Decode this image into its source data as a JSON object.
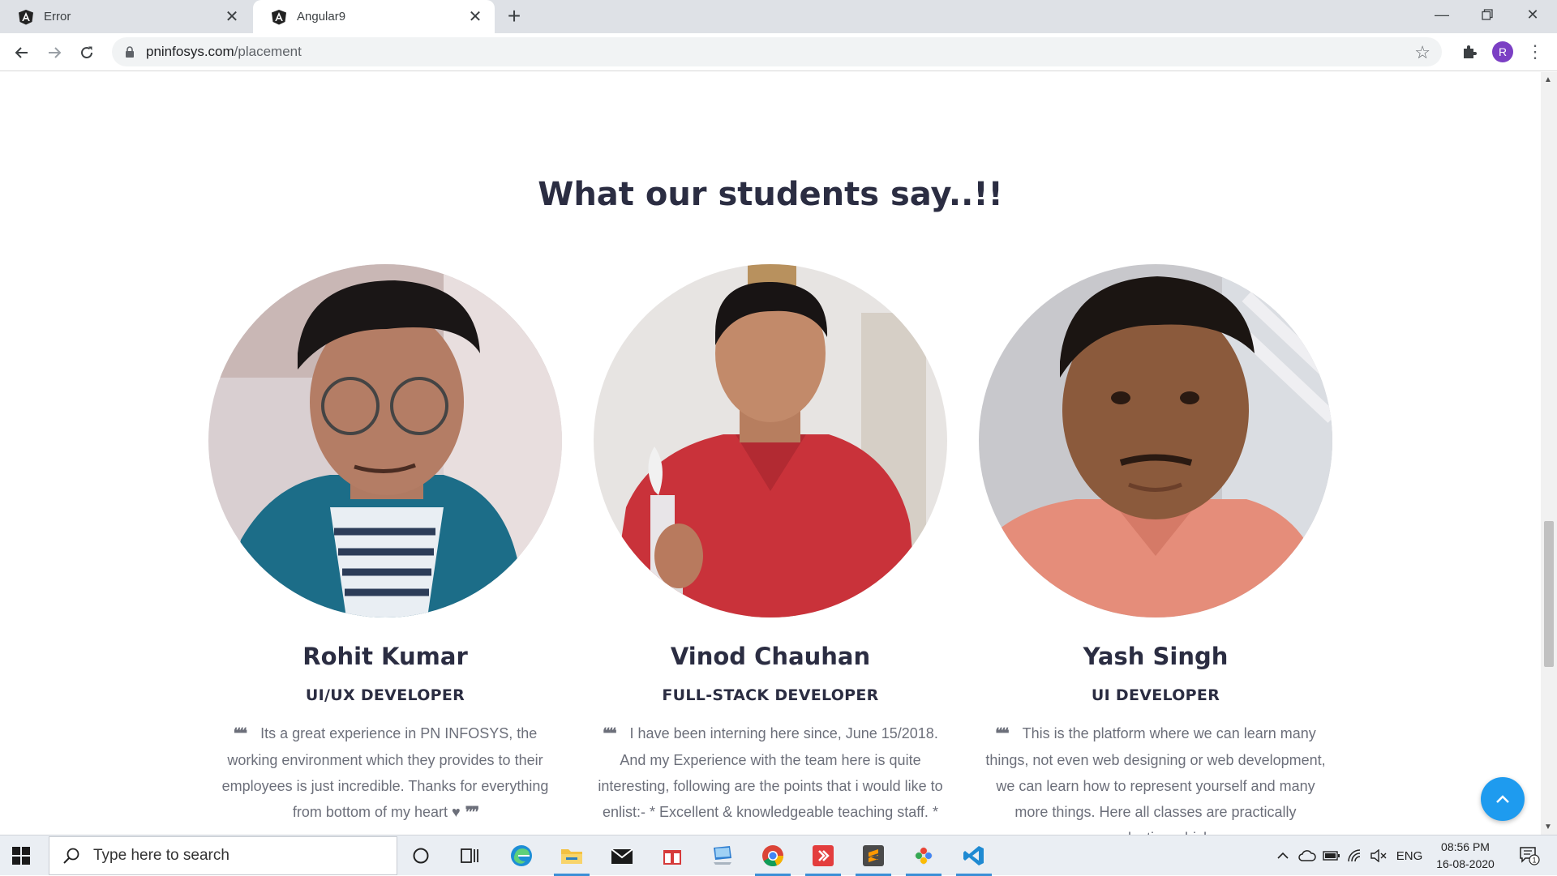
{
  "browser": {
    "tabs": [
      {
        "title": "Error",
        "active": false
      },
      {
        "title": "Angular9",
        "active": true
      }
    ],
    "url_host": "pninfosys.com",
    "url_path": "/placement",
    "profile_initial": "R"
  },
  "section": {
    "title": "What our students say..!!"
  },
  "testimonials": [
    {
      "name": "Rohit Kumar",
      "role": "UI/UX DEVELOPER",
      "open_mark": "❝❝",
      "quote": "Its a great experience in PN INFOSYS, the working environment which they provides to their employees is just incredible. Thanks for everything from bottom of my heart ♥",
      "close_mark": "❞❞"
    },
    {
      "name": "Vinod Chauhan",
      "role": "FULL-STACK DEVELOPER",
      "open_mark": "❝❝",
      "quote": "I have been interning here since, June 15/2018. And my Experience with the team here is quite interesting, following are the points that i would like to enlist:- * Excellent & knowledgeable teaching staff. *"
    },
    {
      "name": "Yash Singh",
      "role": "UI DEVELOPER",
      "open_mark": "❝❝",
      "quote": "This is the platform where we can learn many things, not even web designing or web development, we can learn how to represent yourself and many more things. Here all classes are practically conducting which"
    }
  ],
  "taskbar": {
    "search_placeholder": "Type here to search",
    "language": "ENG",
    "time": "08:56 PM",
    "date": "16-08-2020",
    "notification_count": "1"
  },
  "colors": {
    "heading": "#2b2d42",
    "body_text": "#6c6f7a",
    "accent": "#1e9bef"
  }
}
